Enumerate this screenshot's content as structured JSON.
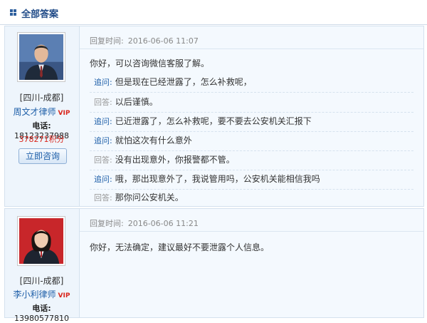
{
  "header": {
    "title": "全部答案"
  },
  "answers": [
    {
      "region": "[四川-成都]",
      "lawyer_name": "周文才律师",
      "vip": "VIP",
      "phone_label": "电话:",
      "phone": "18123237988",
      "points": "378271积分",
      "consult_label": "立即咨询",
      "reply_time_label": "回复时间:",
      "reply_time": "2016-06-06 11:07",
      "answer": "你好，可以咨询微信客服了解。",
      "followups": [
        {
          "type": "q",
          "tag": "追问:",
          "text": "但是现在已经泄露了，怎么补救呢，"
        },
        {
          "type": "a",
          "tag": "回答:",
          "text": "以后谨慎。"
        },
        {
          "type": "q",
          "tag": "追问:",
          "text": "已近泄露了，怎么补救呢，要不要去公安机关汇报下"
        },
        {
          "type": "q",
          "tag": "追问:",
          "text": "就怕这次有什么意外"
        },
        {
          "type": "a",
          "tag": "回答:",
          "text": "没有出现意外，你报警都不管。"
        },
        {
          "type": "q",
          "tag": "追问:",
          "text": "哦，那出现意外了，我说管用吗，公安机关能相信我吗"
        },
        {
          "type": "a",
          "tag": "回答:",
          "text": "那你问公安机关。"
        }
      ]
    },
    {
      "region": "[四川-成都]",
      "lawyer_name": "李小利律师",
      "vip": "VIP",
      "phone_label": "电话:",
      "phone": "13980577810",
      "reply_time_label": "回复时间:",
      "reply_time": "2016-06-06 11:21",
      "answer": "你好，无法确定，建议最好不要泄露个人信息。"
    }
  ]
}
